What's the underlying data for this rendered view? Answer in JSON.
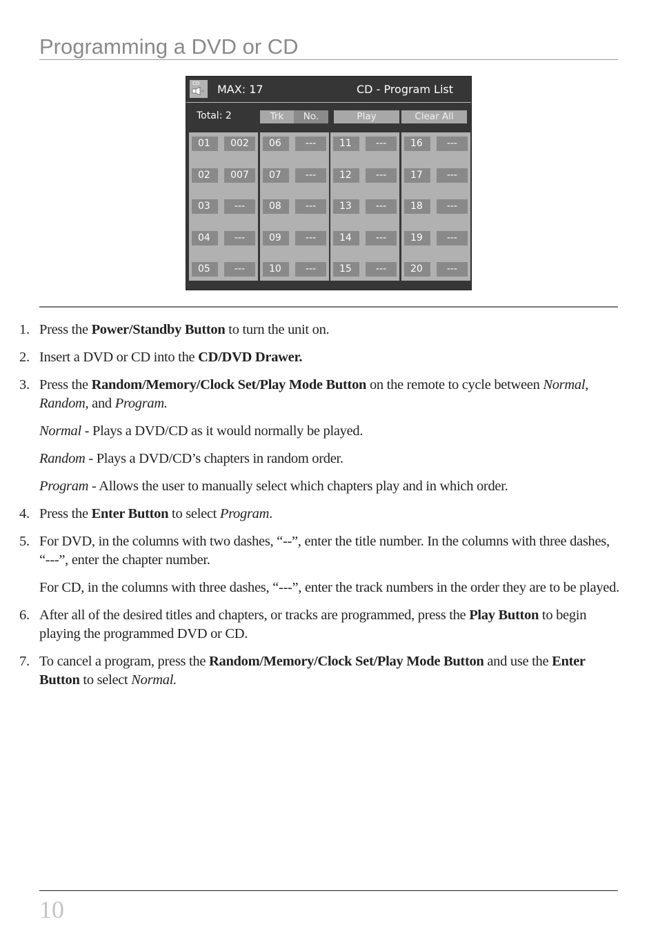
{
  "page": {
    "title": "Programming a DVD or CD",
    "page_number": "10"
  },
  "osd": {
    "icon_label": "CD",
    "max_label": "MAX: 17",
    "list_title": "CD - Program List",
    "total_label": "Total: 2",
    "buttons": {
      "trk": "Trk",
      "no": "No.",
      "play": "Play",
      "clear_all": "Clear All"
    },
    "columns": [
      {
        "slots": [
          {
            "num": "01",
            "val": "002"
          },
          {
            "num": "02",
            "val": "007"
          },
          {
            "num": "03",
            "val": "---"
          },
          {
            "num": "04",
            "val": "---"
          },
          {
            "num": "05",
            "val": "---"
          }
        ]
      },
      {
        "slots": [
          {
            "num": "06",
            "val": "---"
          },
          {
            "num": "07",
            "val": "---"
          },
          {
            "num": "08",
            "val": "---"
          },
          {
            "num": "09",
            "val": "---"
          },
          {
            "num": "10",
            "val": "---"
          }
        ]
      },
      {
        "slots": [
          {
            "num": "11",
            "val": "---"
          },
          {
            "num": "12",
            "val": "---"
          },
          {
            "num": "13",
            "val": "---"
          },
          {
            "num": "14",
            "val": "---"
          },
          {
            "num": "15",
            "val": "---"
          }
        ]
      },
      {
        "slots": [
          {
            "num": "16",
            "val": "---"
          },
          {
            "num": "17",
            "val": "---"
          },
          {
            "num": "18",
            "val": "---"
          },
          {
            "num": "19",
            "val": "---"
          },
          {
            "num": "20",
            "val": "---"
          }
        ]
      }
    ]
  },
  "steps": [
    {
      "n": "1.",
      "parts": [
        [
          "t",
          "Press the "
        ],
        [
          "b",
          "Power/Standby Button"
        ],
        [
          "t",
          " to turn the unit on."
        ]
      ]
    },
    {
      "n": "2.",
      "parts": [
        [
          "t",
          "Insert a DVD or CD into the "
        ],
        [
          "b",
          "CD/DVD Drawer."
        ]
      ]
    },
    {
      "n": "3.",
      "parts": [
        [
          "t",
          "Press the "
        ],
        [
          "b",
          "Random/Memory/Clock Set/Play Mode Button"
        ],
        [
          "t",
          " on the remote to cycle between "
        ],
        [
          "i",
          "Normal, Random,"
        ],
        [
          "t",
          " and "
        ],
        [
          "i",
          "Program."
        ]
      ],
      "subs": [
        [
          [
            "i",
            "Normal"
          ],
          [
            "t",
            " - Plays a DVD/CD as it would normally be played."
          ]
        ],
        [
          [
            "i",
            "Random"
          ],
          [
            "t",
            " - Plays a DVD/CD’s chapters in random order."
          ]
        ],
        [
          [
            "i",
            "Program"
          ],
          [
            "t",
            " - Allows the user to manually select which chapters play and in which order."
          ]
        ]
      ]
    },
    {
      "n": "4.",
      "parts": [
        [
          "t",
          "Press the "
        ],
        [
          "b",
          "Enter Button"
        ],
        [
          "t",
          " to select "
        ],
        [
          "i",
          "Program"
        ],
        [
          "t",
          "."
        ]
      ]
    },
    {
      "n": "5.",
      "parts": [
        [
          "t",
          "For DVD, in the columns with two dashes, “--”, enter the title number.  In the columns with three dashes, “---”, enter the chapter number."
        ]
      ],
      "subs": [
        [
          [
            "t",
            "For CD, in the columns with three dashes, “---”, enter the track numbers in the order they are to be played."
          ]
        ]
      ]
    },
    {
      "n": "6.",
      "parts": [
        [
          "t",
          "After all of the desired titles and chapters, or tracks are programmed, press the "
        ],
        [
          "b",
          "Play Button"
        ],
        [
          "t",
          " to begin playing the programmed DVD or CD."
        ]
      ]
    },
    {
      "n": "7.",
      "parts": [
        [
          "t",
          "To cancel a program, press the "
        ],
        [
          "b",
          "Random/Memory/Clock Set/Play Mode Button"
        ],
        [
          "t",
          " and use the "
        ],
        [
          "b",
          "Enter Button"
        ],
        [
          "t",
          " to select "
        ],
        [
          "i",
          "Normal."
        ]
      ]
    }
  ]
}
